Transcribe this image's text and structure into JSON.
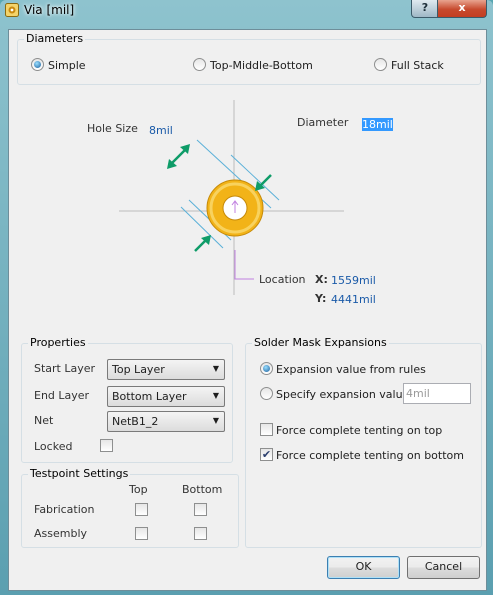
{
  "window": {
    "title": "Via [mil]",
    "help_label": "?",
    "close_label": "x"
  },
  "diameters": {
    "legend": "Diameters",
    "options": [
      {
        "label": "Simple",
        "selected": true
      },
      {
        "label": "Top-Middle-Bottom",
        "selected": false
      },
      {
        "label": "Full Stack",
        "selected": false
      }
    ]
  },
  "diagram": {
    "hole_size_label": "Hole Size",
    "hole_size_value": "8mil",
    "diameter_label": "Diameter",
    "diameter_value": "18mil",
    "location_label": "Location",
    "x_label": "X:",
    "x_value": "1559mil",
    "y_label": "Y:",
    "y_value": "4441mil",
    "colors": {
      "pad": "#f2b318",
      "arrow": "#0e9c68",
      "guide": "#5ab0d8",
      "crosshair": "#bdbdbd",
      "location": "#c080e0"
    }
  },
  "properties": {
    "legend": "Properties",
    "start_layer_label": "Start Layer",
    "start_layer_value": "Top Layer",
    "end_layer_label": "End Layer",
    "end_layer_value": "Bottom Layer",
    "net_label": "Net",
    "net_value": "NetB1_2",
    "locked_label": "Locked",
    "locked_checked": false
  },
  "testpoint": {
    "legend": "Testpoint Settings",
    "top_header": "Top",
    "bottom_header": "Bottom",
    "rows": [
      {
        "label": "Fabrication",
        "top": false,
        "bottom": false
      },
      {
        "label": "Assembly",
        "top": false,
        "bottom": false
      }
    ]
  },
  "solder_mask": {
    "legend": "Solder Mask Expansions",
    "from_rules_label": "Expansion value from rules",
    "from_rules_selected": true,
    "specify_label": "Specify expansion value",
    "specify_value": "4mil",
    "tent_top_label": "Force complete tenting on top",
    "tent_top_checked": false,
    "tent_bottom_label": "Force complete tenting on bottom",
    "tent_bottom_checked": true
  },
  "buttons": {
    "ok": "OK",
    "cancel": "Cancel"
  }
}
